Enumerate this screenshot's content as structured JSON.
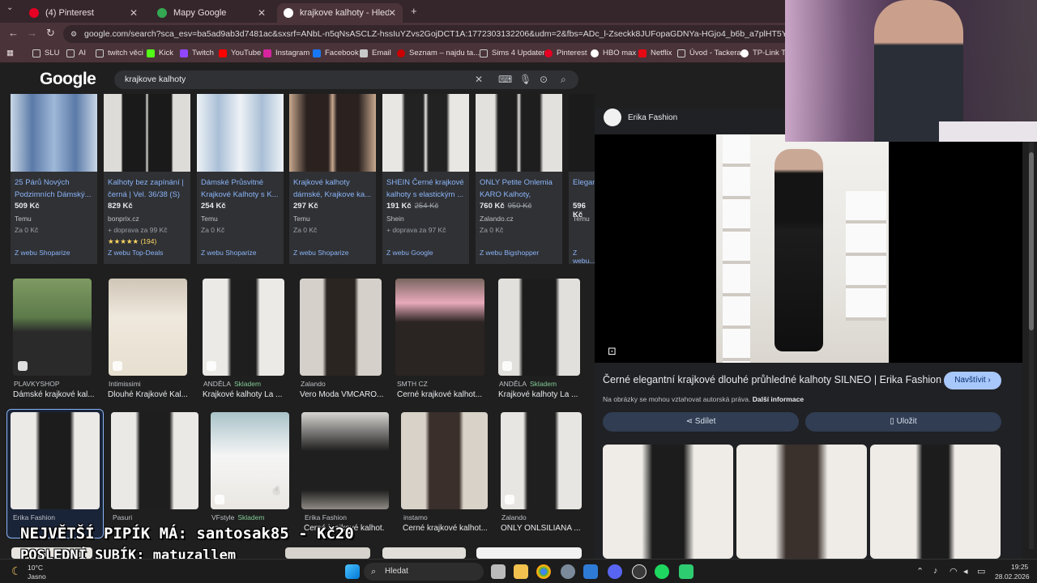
{
  "tabs": [
    {
      "label": "(4) Pinterest",
      "color": "#e60023"
    },
    {
      "label": "Mapy Google",
      "color": "#34a853"
    },
    {
      "label": "krajkove kalhoty - Hledat Goog",
      "color": "#ffffff"
    }
  ],
  "url": "google.com/search?sca_esv=ba5ad9ab3d7481ac&sxsrf=ANbL-n5qNsASCLZ-hssIuYZvs2GojDCT1A:1772303132206&udm=2&fbs=ADc_l-Zseckk8JUFopaGDNYa-HGjo4_b6b_a7plHT5Y9QnExq9Rc1h0y7XW95sKH",
  "bookmarks": [
    "SLU",
    "AI",
    "twitch věci",
    "Kick",
    "Twitch",
    "YouTube",
    "Instagram",
    "Facebook",
    "Email",
    "Seznam – najdu ta...",
    "Sims 4 Updater",
    "Pinterest",
    "HBO max",
    "Netflix",
    "Úvod - Tackera",
    "TP-Link TL"
  ],
  "google": {
    "logo": "Google",
    "query": "krajkove kalhoty"
  },
  "shopping": [
    {
      "title": "25 Párů Nových Podzimních Dámský...",
      "price": "509 Kč",
      "old": "",
      "shop": "Temu",
      "ship": "Za 0 Kč",
      "rating": "",
      "from": "Z webu Shoparize",
      "c1": "#5b7aa8",
      "c2": "#9fb8d8"
    },
    {
      "title": "Kalhoty bez zapínání | černá | Vel. 36/38 (S)",
      "price": "829 Kč",
      "old": "",
      "shop": "bonprix.cz",
      "ship": "+ doprava za 99 Kč",
      "rating": "★★★★★ (194)",
      "from": "Z webu Top-Deals",
      "c1": "#1a1a1a",
      "c2": "#dedcd8"
    },
    {
      "title": "Dámské Průsvitné Krajkové Kalhoty s K...",
      "price": "254 Kč",
      "old": "",
      "shop": "Temu",
      "ship": "Za 0 Kč",
      "rating": "",
      "from": "Z webu Shoparize",
      "c1": "#a9bfd6",
      "c2": "#eef2f6"
    },
    {
      "title": "Krajkové kalhoty dámské, Krajkove ka...",
      "price": "297 Kč",
      "old": "",
      "shop": "Temu",
      "ship": "Za 0 Kč",
      "rating": "",
      "from": "Z webu Shoparize",
      "c1": "#2b2220",
      "c2": "#c9a98f"
    },
    {
      "title": "SHEIN Černé krajkové kalhoty s elastickým ...",
      "price": "191 Kč",
      "old": "254 Kč",
      "shop": "Shein",
      "ship": "+ doprava za 97 Kč",
      "rating": "",
      "from": "Z webu Google",
      "c1": "#222",
      "c2": "#e9e7e4"
    },
    {
      "title": "ONLY Petite Onlemia KARO Kalhoty,",
      "price": "760 Kč",
      "old": "950 Kč",
      "shop": "Zalando.cz",
      "ship": "Za 0 Kč",
      "rating": "",
      "from": "Z webu Bigshopper",
      "c1": "#1e1e1e",
      "c2": "#e3e1dd"
    },
    {
      "title": "Elegant... kalhoty...",
      "price": "596 Kč",
      "old": "",
      "shop": "Temu",
      "ship": "Za 0 Kč",
      "rating": "",
      "from": "Z webu...",
      "c1": "#1b1b1b",
      "c2": "#cfd6de"
    }
  ],
  "row1": [
    {
      "src": "PLAVKYSHOP",
      "stock": "",
      "title": "Dámské krajkové kal...",
      "c": "#6d7a4e"
    },
    {
      "src": "Intimissimi",
      "stock": "",
      "title": "Dlouhé Krajkové Kal...",
      "c": "#d9d0c2"
    },
    {
      "src": "ANDĚLA",
      "stock": "Skladem",
      "title": "Krajkové kalhoty La ...",
      "c": "#e9e7e4"
    },
    {
      "src": "Zalando",
      "stock": "",
      "title": "Vero Moda VMCARO...",
      "c": "#cfcac4"
    },
    {
      "src": "SMTH CZ",
      "stock": "",
      "title": "Černé krajkové kalhot...",
      "c": "#6d5a55"
    },
    {
      "src": "ANDĚLA",
      "stock": "Skladem",
      "title": "Krajkové kalhoty La ...",
      "c": "#e2e0dc"
    }
  ],
  "row2": [
    {
      "src": "Erika Fashion",
      "stock": "",
      "title": "Černé elegantní...",
      "c": "#eceae6"
    },
    {
      "src": "Pasuri",
      "stock": "",
      "title": "Černé krajkové kalho...",
      "c": "#ebe9e5"
    },
    {
      "src": "VFstyle",
      "stock": "Skladem",
      "title": "Krajkové kalhoty...",
      "c": "#a9c3c9"
    },
    {
      "src": "Erika Fashion",
      "stock": "",
      "title": "Černé krajkové kalhot...",
      "c": "#d8d6d2"
    },
    {
      "src": "instamo",
      "stock": "",
      "title": "Černé krajkové kalhot...",
      "c": "#d9d2c8"
    },
    {
      "src": "Zalando",
      "stock": "",
      "title": "ONLY ONLSILIANA ...",
      "c": "#e8e6e2"
    }
  ],
  "panel": {
    "source": "Erika Fashion",
    "title": "Černé elegantní krajkové dlouhé průhledné kalhoty SILNEO | Erika Fashion",
    "visit": "Navštívit",
    "rights": "Na obrázky se mohou vztahovat autorská práva.",
    "more": "Další informace",
    "share": "Sdílet",
    "save": "Uložit"
  },
  "overlay": {
    "line1": "NEJVĚTŠÍ PIPÍK MÁ: santosak85 - Kč20",
    "line2": "POSLEDNÍ SUBÍK: matuzallem"
  },
  "taskbar": {
    "weather_temp": "10°C",
    "weather_desc": "Jasno",
    "search": "Hledat",
    "time": "19:25",
    "date": "28.02.2026"
  }
}
